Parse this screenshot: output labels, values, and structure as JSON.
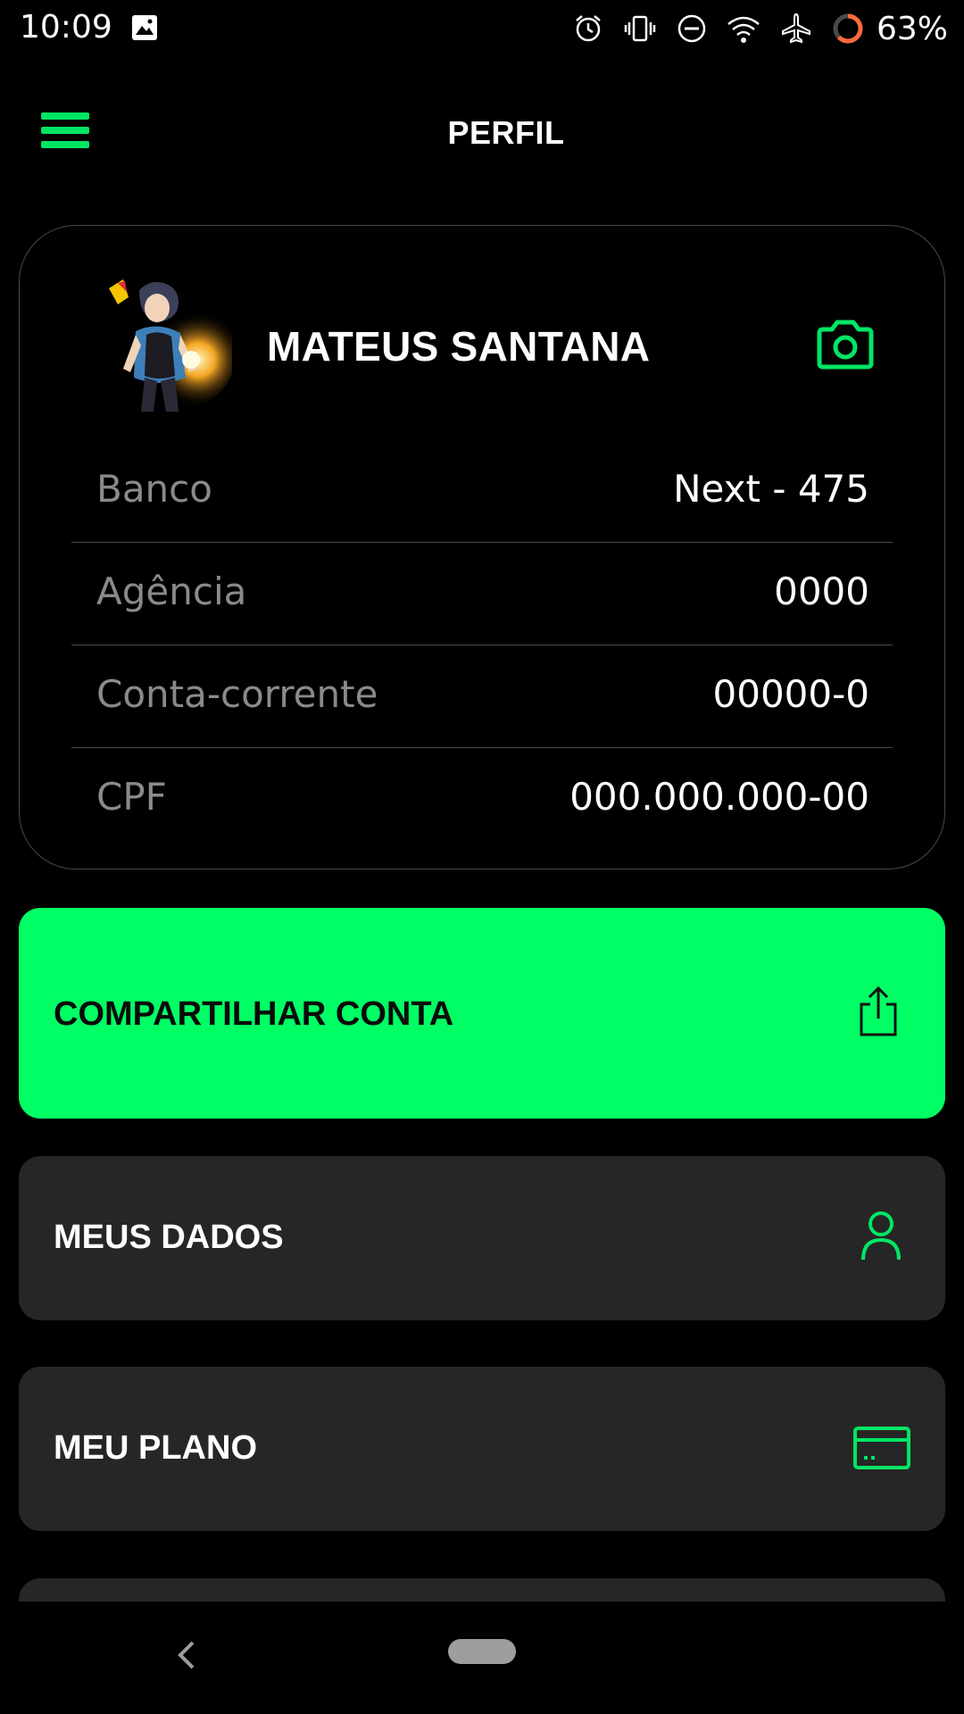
{
  "status_bar": {
    "time": "10:09",
    "battery_percent": "63%",
    "battery_level": 0.63,
    "icons": [
      "image-icon",
      "alarm-icon",
      "vibrate-icon",
      "do-not-disturb-icon",
      "wifi-icon",
      "airplane-icon",
      "battery-icon"
    ]
  },
  "header": {
    "title": "PERFIL",
    "menu_icon": "hamburger-menu-icon"
  },
  "profile": {
    "name": "MATEUS SANTANA",
    "camera_icon": "camera-icon",
    "rows": [
      {
        "label": "Banco",
        "value": "Next - 475"
      },
      {
        "label": "Agência",
        "value": "0000"
      },
      {
        "label": "Conta-corrente",
        "value": "00000-0"
      },
      {
        "label": "CPF",
        "value": "000.000.000-00"
      }
    ]
  },
  "actions": {
    "share": {
      "label": "COMPARTILHAR CONTA",
      "icon": "share-icon"
    },
    "my_data": {
      "label": "MEUS DADOS",
      "icon": "user-icon"
    },
    "my_plan": {
      "label": "MEU PLANO",
      "icon": "credit-card-icon"
    }
  },
  "colors": {
    "accent": "#00ff64",
    "background": "#000000",
    "card": "#262626",
    "muted_text": "#8a8a8a"
  }
}
